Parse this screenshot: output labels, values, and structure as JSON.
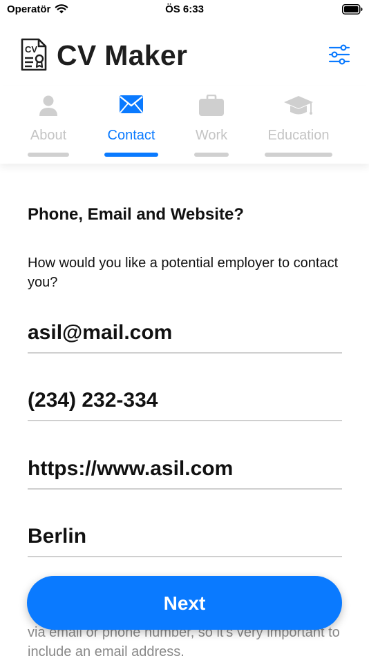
{
  "status_bar": {
    "carrier": "Operatör",
    "time": "ÖS 6:33"
  },
  "header": {
    "title": "CV Maker",
    "logo_icon": "cv-document-icon",
    "settings_icon": "sliders-icon"
  },
  "tabs": [
    {
      "label": "About",
      "icon": "person-icon",
      "active": false
    },
    {
      "label": "Contact",
      "icon": "envelope-icon",
      "active": true
    },
    {
      "label": "Work",
      "icon": "briefcase-icon",
      "active": false
    },
    {
      "label": "Education",
      "icon": "graduation-cap-icon",
      "active": false
    }
  ],
  "contact": {
    "question": "Phone, Email and Website?",
    "prompt": "How would you like a potential employer to contact you?",
    "fields": {
      "email": "asil@mail.com",
      "phone": "(234) 232-334",
      "website": "https://www.asil.com",
      "city": "Berlin"
    },
    "hint": "via email or phone number, so it's very important to include an email address."
  },
  "footer": {
    "next_label": "Next"
  },
  "colors": {
    "accent": "#0a7aff",
    "inactive": "#c4c4c4",
    "title": "#1e1e1e"
  }
}
